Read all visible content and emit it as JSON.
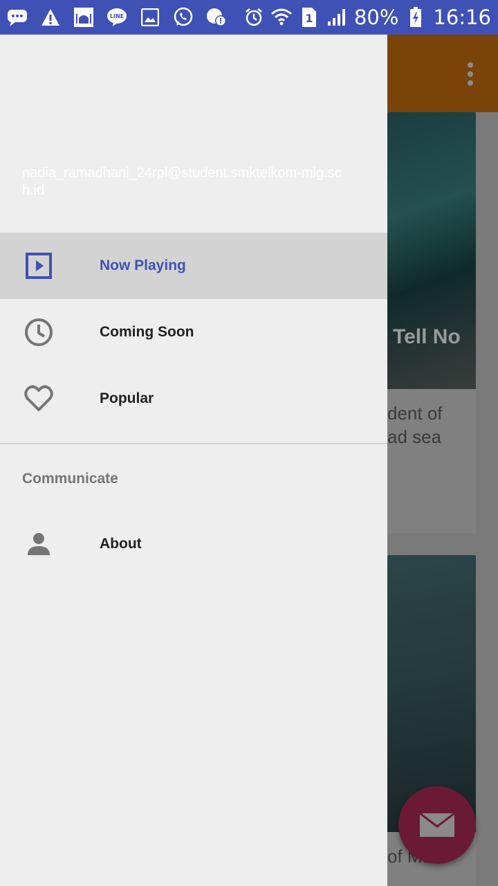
{
  "status_bar": {
    "battery": "80%",
    "time": "16:16",
    "sim_slot": "1",
    "left_icons": [
      "messages-icon",
      "warning-icon",
      "mosque-app-icon",
      "line-icon",
      "gallery-icon",
      "whatsapp-icon",
      "chat-alert-icon"
    ],
    "right_icons": [
      "alarm-icon",
      "wifi-icon",
      "sim-icon",
      "signal-icon",
      "battery-charging-icon"
    ]
  },
  "background_screen": {
    "card1": {
      "title_fragment": "Tell No",
      "overview_fragment": [
        "dent of",
        "ad sea"
      ]
    },
    "card2": {
      "title_fragment": "of Ma"
    }
  },
  "drawer": {
    "user_email": "nadia_ramadhani_24rpl@student.smktelkom-mlg.sch.id",
    "menu": [
      {
        "label": "Now Playing",
        "icon": "play-box-icon",
        "selected": true
      },
      {
        "label": "Coming Soon",
        "icon": "clock-icon",
        "selected": false
      },
      {
        "label": "Popular",
        "icon": "heart-icon",
        "selected": false
      }
    ],
    "section_title": "Communicate",
    "communicate_items": [
      {
        "label": "About",
        "icon": "person-icon"
      }
    ]
  },
  "colors": {
    "primary": "#3f51b5",
    "toolbar_dimmed": "#7a4409",
    "fab_dimmed": "#6b1a35",
    "drawer_bg": "#eeeeee",
    "selected_bg": "#d3d3d3"
  }
}
